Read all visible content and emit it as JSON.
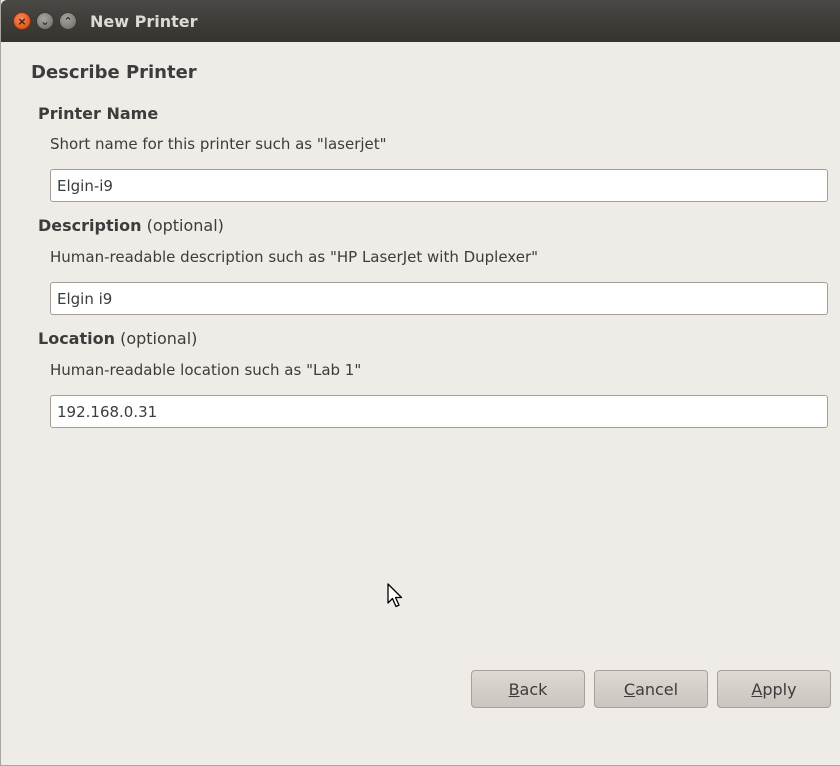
{
  "window": {
    "title": "New Printer",
    "controls": {
      "close_glyph": "×",
      "minimize_glyph": "⌄",
      "maximize_glyph": "⌃"
    }
  },
  "page": {
    "heading": "Describe Printer"
  },
  "fields": {
    "name": {
      "label": "Printer Name",
      "optional": "",
      "hint": "Short name for this printer such as \"laserjet\"",
      "value": "Elgin-i9"
    },
    "description": {
      "label": "Description",
      "optional": " (optional)",
      "hint": "Human-readable description such as \"HP LaserJet with Duplexer\"",
      "value": "Elgin i9"
    },
    "location": {
      "label": "Location",
      "optional": " (optional)",
      "hint": "Human-readable location such as \"Lab 1\"",
      "value": "192.168.0.31"
    }
  },
  "buttons": {
    "back": {
      "mnemonic": "B",
      "rest": "ack"
    },
    "cancel": {
      "mnemonic": "C",
      "rest": "ancel"
    },
    "apply": {
      "mnemonic": "A",
      "rest": "pply"
    }
  },
  "icons": {
    "close": "close-icon",
    "minimize": "minimize-icon",
    "maximize": "maximize-icon",
    "pointer": "mouse-pointer-icon"
  }
}
